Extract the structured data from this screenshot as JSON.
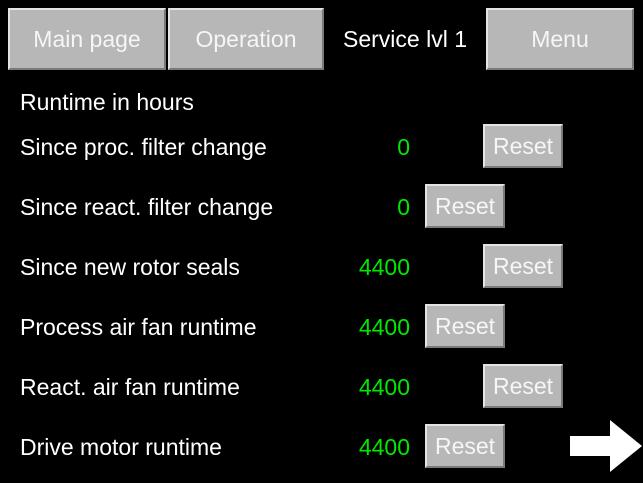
{
  "tabs": {
    "main_page": "Main page",
    "operation": "Operation",
    "service_lvl1": "Service lvl 1",
    "menu": "Menu"
  },
  "section_title": "Runtime in hours",
  "rows": [
    {
      "label": "Since proc. filter change",
      "value": "0",
      "button": "Reset"
    },
    {
      "label": "Since react. filter change",
      "value": "0",
      "button": "Reset"
    },
    {
      "label": "Since new rotor seals",
      "value": "4400",
      "button": "Reset"
    },
    {
      "label": "Process air fan runtime",
      "value": "4400",
      "button": "Reset"
    },
    {
      "label": "React. air fan runtime",
      "value": "4400",
      "button": "Reset"
    },
    {
      "label": "Drive motor runtime",
      "value": "4400",
      "button": "Reset"
    }
  ],
  "next_icon": "arrow-right-icon",
  "colors": {
    "background": "#000000",
    "button_face": "#b7b7b7",
    "value_text": "#00e800",
    "label_text": "#ffffff"
  }
}
